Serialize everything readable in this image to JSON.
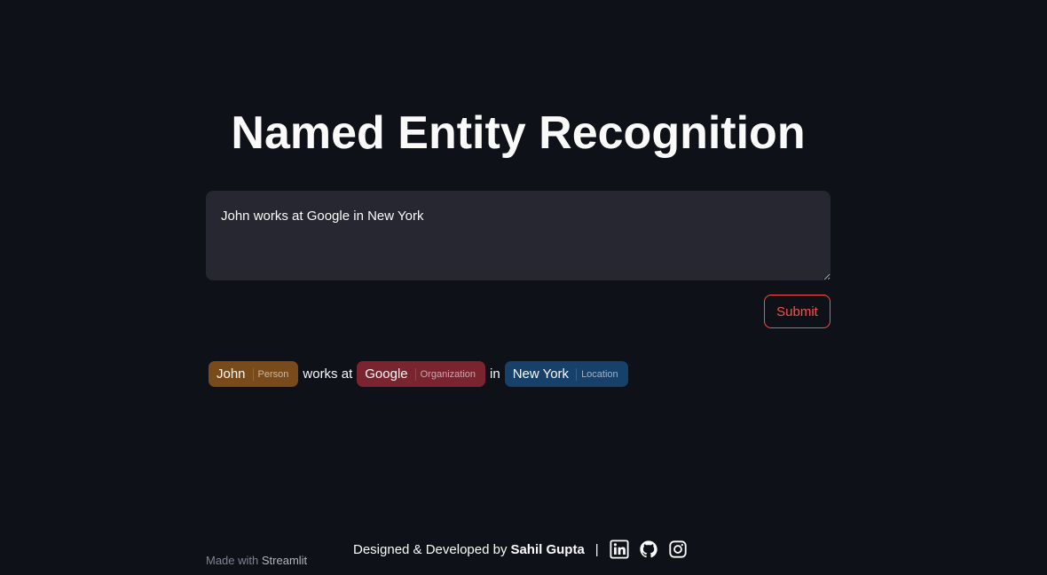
{
  "title": "Named Entity Recognition",
  "input": {
    "value": "John works at Google in New York"
  },
  "submit_label": "Submit",
  "result": {
    "tokens": [
      {
        "text": "John",
        "label": "Person",
        "color": "#7a4b1a"
      },
      {
        "text": "works at"
      },
      {
        "text": "Google",
        "label": "Organization",
        "color": "#7a2430"
      },
      {
        "text": "in"
      },
      {
        "text": "New York",
        "label": "Location",
        "color": "#17406b"
      }
    ]
  },
  "footer": {
    "made_with": "Made with",
    "brand": "Streamlit"
  },
  "credits": {
    "prefix": "Designed & Developed by",
    "name": "Sahil Gupta",
    "separator": "|",
    "icons": [
      "linkedin-icon",
      "github-icon",
      "instagram-icon"
    ]
  },
  "colors": {
    "background": "#0e1117",
    "accent": "#ff4b4b",
    "input_bg": "#262730"
  }
}
